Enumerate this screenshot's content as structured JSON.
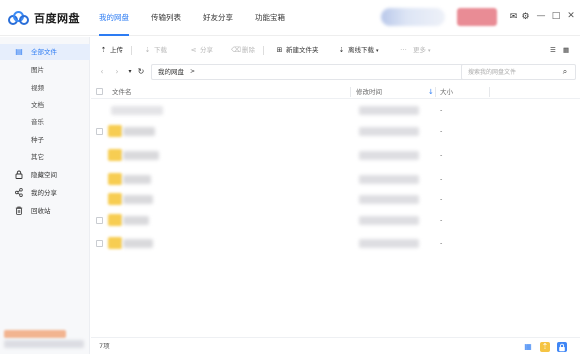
{
  "app": {
    "name": "百度网盘"
  },
  "nav": {
    "tabs": [
      {
        "label": "我的网盘",
        "active": true
      },
      {
        "label": "传输列表",
        "active": false
      },
      {
        "label": "好友分享",
        "active": false
      },
      {
        "label": "功能宝箱",
        "active": false
      }
    ]
  },
  "topbar": {
    "icons": [
      "mail-icon",
      "gear-icon",
      "minimize-icon",
      "maximize-icon",
      "close-icon"
    ],
    "mail_glyph": "✉",
    "settings_glyph": "⚙",
    "minimize_glyph": "—",
    "maximize_glyph": "□",
    "close_glyph": "✕"
  },
  "sidebar": {
    "items": [
      {
        "label": "全部文件",
        "icon": "document-icon",
        "glyph": "▤",
        "active": true
      },
      {
        "label": "图片",
        "sub": true
      },
      {
        "label": "视频",
        "sub": true
      },
      {
        "label": "文档",
        "sub": true
      },
      {
        "label": "音乐",
        "sub": true
      },
      {
        "label": "种子",
        "sub": true
      },
      {
        "label": "其它",
        "sub": true
      },
      {
        "label": "隐藏空间",
        "icon": "lock-icon",
        "glyph": "🔒"
      },
      {
        "label": "我的分享",
        "icon": "share-icon",
        "glyph": "⋖"
      },
      {
        "label": "回收站",
        "icon": "trash-icon",
        "glyph": "🗑"
      }
    ]
  },
  "toolbar": {
    "upload": "上传",
    "download": "下载",
    "share": "分享",
    "delete": "删除",
    "new_folder": "新建文件夹",
    "offline_download": "离线下载",
    "more": "更多",
    "upload_glyph": "⇡",
    "download_glyph": "⇣",
    "share_glyph": "⋖",
    "delete_glyph": "⌫",
    "new_folder_glyph": "⊞",
    "offline_glyph": "⇣",
    "more_glyph": "···",
    "caret": "▾",
    "sort_glyph": "☰",
    "view_glyph": "▦"
  },
  "address": {
    "back_glyph": "‹",
    "forward_glyph": "›",
    "dropdown_glyph": "▾",
    "refresh_glyph": "↻",
    "crumb": "我的网盘",
    "crumb_arrow": ">",
    "search_placeholder": "搜索我的网盘文件",
    "search_value": "",
    "search_glyph": "⌕"
  },
  "list": {
    "columns": {
      "name": "文件名",
      "modified": "修改时间",
      "size": "大小"
    },
    "sort_glyph": "↓",
    "rows": [
      {
        "size": "-"
      },
      {
        "size": "-"
      },
      {
        "size": "-"
      },
      {
        "size": "-"
      },
      {
        "size": "-"
      },
      {
        "size": "-"
      },
      {
        "size": "-"
      }
    ]
  },
  "status": {
    "count": "7项",
    "grid_glyph": "▦",
    "upload_glyph": "⇡",
    "lock_glyph": "🔒"
  },
  "colors": {
    "accent": "#2d7cf3",
    "folder": "#f7cd52",
    "sidebar_bg": "#f7f8fa",
    "active_bg": "#e6eefc"
  }
}
